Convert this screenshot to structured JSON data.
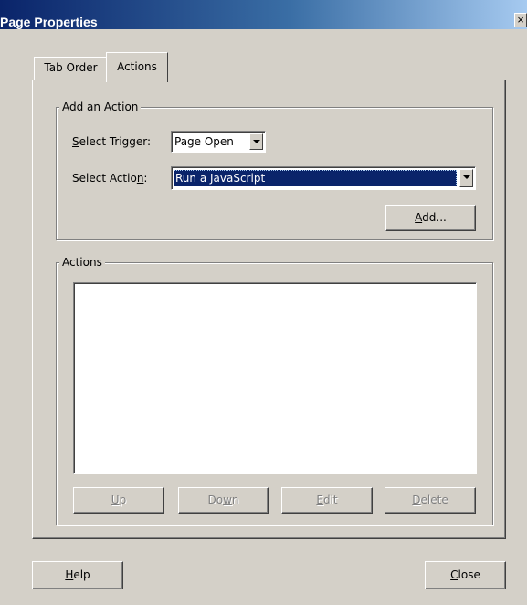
{
  "window": {
    "title": "Page Properties",
    "close_glyph": "×"
  },
  "tabs": [
    {
      "label": "Tab Order",
      "selected": false
    },
    {
      "label": "Actions",
      "selected": true
    }
  ],
  "add_action_group": {
    "label": "Add an Action",
    "trigger": {
      "label_pre": "",
      "label_mnemonic": "S",
      "label_post": "elect Trigger:",
      "value": "Page Open"
    },
    "action": {
      "label_pre": "Select Actio",
      "label_mnemonic": "n",
      "label_post": ":",
      "value": "Run a JavaScript"
    },
    "add_button": {
      "label_pre": "",
      "label_mnemonic": "A",
      "label_post": "dd..."
    }
  },
  "actions_group": {
    "label": "Actions",
    "items": [],
    "buttons": {
      "up": {
        "label_pre": "",
        "label_mnemonic": "U",
        "label_post": "p",
        "enabled": false
      },
      "down": {
        "label_pre": "Do",
        "label_mnemonic": "w",
        "label_post": "n",
        "enabled": false
      },
      "edit": {
        "label_pre": "",
        "label_mnemonic": "E",
        "label_post": "dit",
        "enabled": false
      },
      "delete": {
        "label_pre": "",
        "label_mnemonic": "D",
        "label_post": "elete",
        "enabled": false
      }
    }
  },
  "footer": {
    "help": {
      "label_pre": "",
      "label_mnemonic": "H",
      "label_post": "elp"
    },
    "close": {
      "label_pre": "",
      "label_mnemonic": "C",
      "label_post": "lose"
    }
  },
  "colors": {
    "dialog_bg": "#d4d0c8",
    "title_start": "#0a246a",
    "title_end": "#a6caf0",
    "selection_bg": "#0a246a",
    "disabled_text": "#808080"
  },
  "icons": {
    "close": "close-icon",
    "dropdown": "chevron-down-icon"
  }
}
